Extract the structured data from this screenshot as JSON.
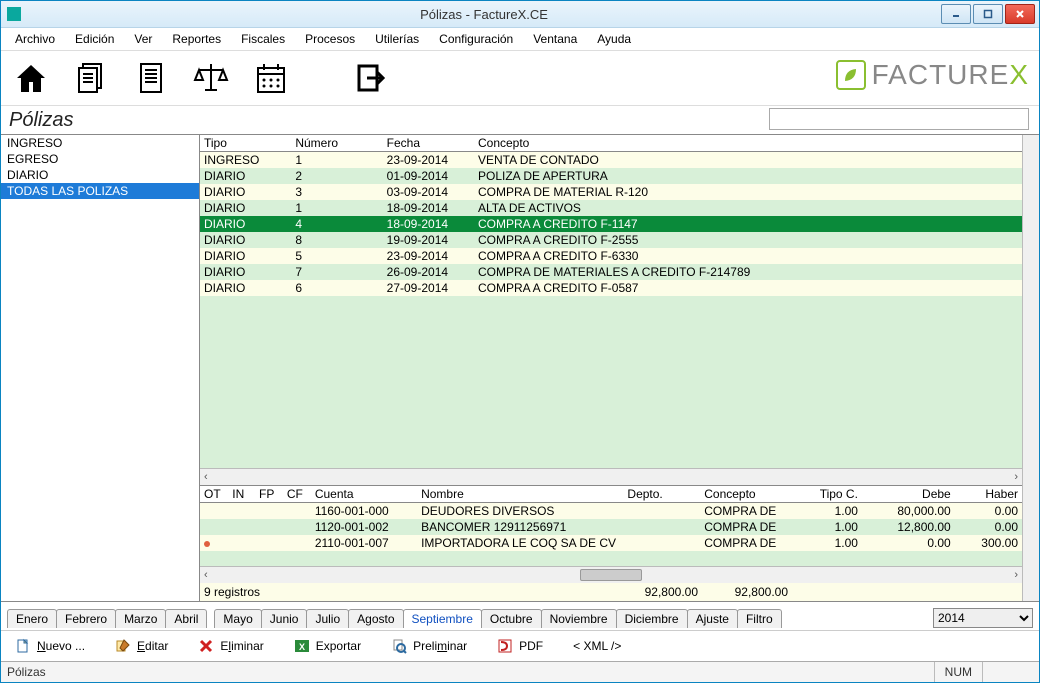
{
  "window_title": "Pólizas - FactureX.CE",
  "menus": [
    "Archivo",
    "Edición",
    "Ver",
    "Reportes",
    "Fiscales",
    "Procesos",
    "Utilerías",
    "Configuración",
    "Ventana",
    "Ayuda"
  ],
  "brand": {
    "name": "FACTURE",
    "suffix": "X"
  },
  "section_title": "Pólizas",
  "search_value": "",
  "sidebar": {
    "items": [
      "INGRESO",
      "EGRESO",
      "DIARIO",
      "TODAS LAS POLIZAS"
    ],
    "selected_index": 3
  },
  "top_table": {
    "headers": [
      "Tipo",
      "Número",
      "Fecha",
      "Concepto"
    ],
    "rows": [
      {
        "tipo": "INGRESO",
        "num": "1",
        "fecha": "23-09-2014",
        "concepto": "VENTA DE CONTADO"
      },
      {
        "tipo": "DIARIO",
        "num": "2",
        "fecha": "01-09-2014",
        "concepto": "POLIZA DE APERTURA"
      },
      {
        "tipo": "DIARIO",
        "num": "3",
        "fecha": "03-09-2014",
        "concepto": "COMPRA DE MATERIAL R-120"
      },
      {
        "tipo": "DIARIO",
        "num": "1",
        "fecha": "18-09-2014",
        "concepto": "ALTA DE ACTIVOS"
      },
      {
        "tipo": "DIARIO",
        "num": "4",
        "fecha": "18-09-2014",
        "concepto": "COMPRA A CREDITO F-1147"
      },
      {
        "tipo": "DIARIO",
        "num": "8",
        "fecha": "19-09-2014",
        "concepto": "COMPRA A CREDITO F-2555"
      },
      {
        "tipo": "DIARIO",
        "num": "5",
        "fecha": "23-09-2014",
        "concepto": "COMPRA A CREDITO F-6330"
      },
      {
        "tipo": "DIARIO",
        "num": "7",
        "fecha": "26-09-2014",
        "concepto": "COMPRA DE MATERIALES A CREDITO F-214789"
      },
      {
        "tipo": "DIARIO",
        "num": "6",
        "fecha": "27-09-2014",
        "concepto": "COMPRA A CREDITO F-0587"
      }
    ],
    "selected_index": 4
  },
  "detail_table": {
    "headers": [
      "OT",
      "IN",
      "FP",
      "CF",
      "Cuenta",
      "Nombre",
      "Depto.",
      "Concepto",
      "Tipo C.",
      "Debe",
      "Haber"
    ],
    "rows": [
      {
        "ot": "",
        "in": "",
        "fp": "",
        "cf": "",
        "cuenta": "1160-001-000",
        "nombre": "DEUDORES DIVERSOS",
        "depto": "",
        "concepto": "COMPRA DE",
        "tipoc": "1.00",
        "debe": "80,000.00",
        "haber": "0.00"
      },
      {
        "ot": "",
        "in": "",
        "fp": "",
        "cf": "",
        "cuenta": "1120-001-002",
        "nombre": "BANCOMER  12911256971",
        "depto": "",
        "concepto": "COMPRA DE",
        "tipoc": "1.00",
        "debe": "12,800.00",
        "haber": "0.00"
      },
      {
        "ot": "",
        "in": "",
        "fp": "",
        "cf": "",
        "cuenta": "2110-001-007",
        "nombre": "IMPORTADORA LE COQ SA DE CV",
        "depto": "",
        "concepto": "COMPRA DE",
        "tipoc": "1.00",
        "debe": "0.00",
        "haber": "300.00",
        "mark": true
      }
    ]
  },
  "totals": {
    "label": "9 registros",
    "debe": "92,800.00",
    "haber": "92,800.00"
  },
  "tabs_left": [
    "Enero",
    "Febrero",
    "Marzo",
    "Abril"
  ],
  "tabs_right": [
    "Mayo",
    "Junio",
    "Julio",
    "Agosto",
    "Septiembre",
    "Octubre",
    "Noviembre",
    "Diciembre",
    "Ajuste",
    "Filtro"
  ],
  "active_tab": "Septiembre",
  "year": "2014",
  "bottom_buttons": {
    "nuevo": "Nuevo ...",
    "editar": "Editar",
    "eliminar": "Eliminar",
    "exportar": "Exportar",
    "preliminar": "Preliminar",
    "pdf": "PDF",
    "xml": "< XML />"
  },
  "status_left": "Pólizas",
  "status_num": "NUM"
}
